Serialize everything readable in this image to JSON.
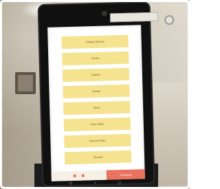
{
  "kiosk": {
    "sticker_text": "",
    "menu_items": [
      {
        "label": "Todays Special"
      },
      {
        "label": "Drinks"
      },
      {
        "label": "Bagels"
      },
      {
        "label": "Salads"
      },
      {
        "label": "Melts"
      },
      {
        "label": "Plain Sides"
      },
      {
        "label": "Special Sides"
      },
      {
        "label": "Dessert"
      }
    ],
    "bottom_bar": {
      "checkout_label": "Checkout",
      "accent_color": "#e9735f"
    },
    "colors": {
      "button_fill": "#f6e38f",
      "screen_bg": "#ffffff"
    }
  }
}
